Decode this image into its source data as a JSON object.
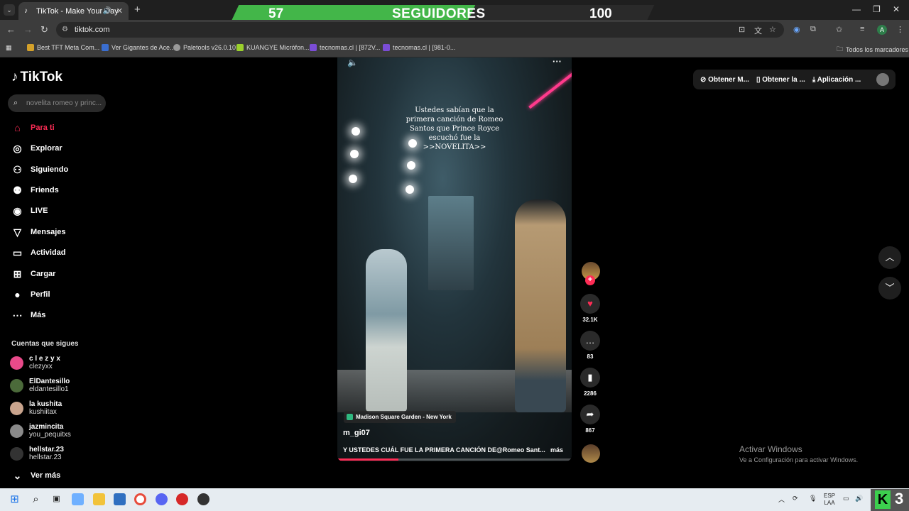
{
  "browser": {
    "tab_title": "TikTok - Make Your Day",
    "url": "tiktok.com",
    "bookmarks": [
      "Best TFT Meta Com...",
      "Ver Gigantes de Ace...",
      "Paletools v26.0.10",
      "KUANGYE Micrófon...",
      "tecnomas.cl | [872V...",
      "tecnomas.cl | [981-0..."
    ],
    "all_bookmarks": "Todos los marcadores",
    "profile_initial": "A"
  },
  "overlay": {
    "current_followers": "57",
    "label": "SEGUIDORES",
    "goal": "100",
    "progress": 0.57
  },
  "tiktok": {
    "logo": "TikTok",
    "search_placeholder": "novelita romeo y princ...",
    "nav": [
      {
        "label": "Para ti",
        "icon": "home-icon"
      },
      {
        "label": "Explorar",
        "icon": "compass-icon"
      },
      {
        "label": "Siguiendo",
        "icon": "following-icon"
      },
      {
        "label": "Friends",
        "icon": "friends-icon"
      },
      {
        "label": "LIVE",
        "icon": "live-icon"
      },
      {
        "label": "Mensajes",
        "icon": "messages-icon"
      },
      {
        "label": "Actividad",
        "icon": "activity-icon"
      },
      {
        "label": "Cargar",
        "icon": "upload-icon"
      },
      {
        "label": "Perfil",
        "icon": "profile-icon"
      },
      {
        "label": "Más",
        "icon": "more-icon"
      }
    ],
    "following_title": "Cuentas que sigues",
    "following": [
      {
        "name": "c l e z y x",
        "handle": "clezyxx"
      },
      {
        "name": "ElDantesillo",
        "handle": "eldantesillo1"
      },
      {
        "name": "la kushita",
        "handle": "kushiitax"
      },
      {
        "name": "jazmincita",
        "handle": "you_pequitxs"
      },
      {
        "name": "hellstar.23",
        "handle": "hellstar.23"
      }
    ],
    "see_more": "Ver más",
    "top_actions": [
      "Obtener M...",
      "Obtener la ...",
      "Aplicación ..."
    ]
  },
  "video": {
    "overlay_text": "Ustedes sabían que la primera canción de Romeo Santos que Prince Royce escuchó fue la >>NOVELITA>>",
    "location": "Madison Square Garden - New York",
    "author": "m_gi07",
    "description": "Y USTEDES CUÁL FUE LA PRIMERA CANCIÓN DE@Romeo Sant...",
    "more": "más",
    "progress": 0.26,
    "likes": "32.1K",
    "comments": "83",
    "saves": "2286",
    "shares": "867"
  },
  "windows": {
    "activate_title": "Activar Windows",
    "activate_subtitle": "Ve a Configuración para activar Windows.",
    "lang_line1": "ESP",
    "lang_line2": "LAA",
    "badge_number": "3"
  }
}
